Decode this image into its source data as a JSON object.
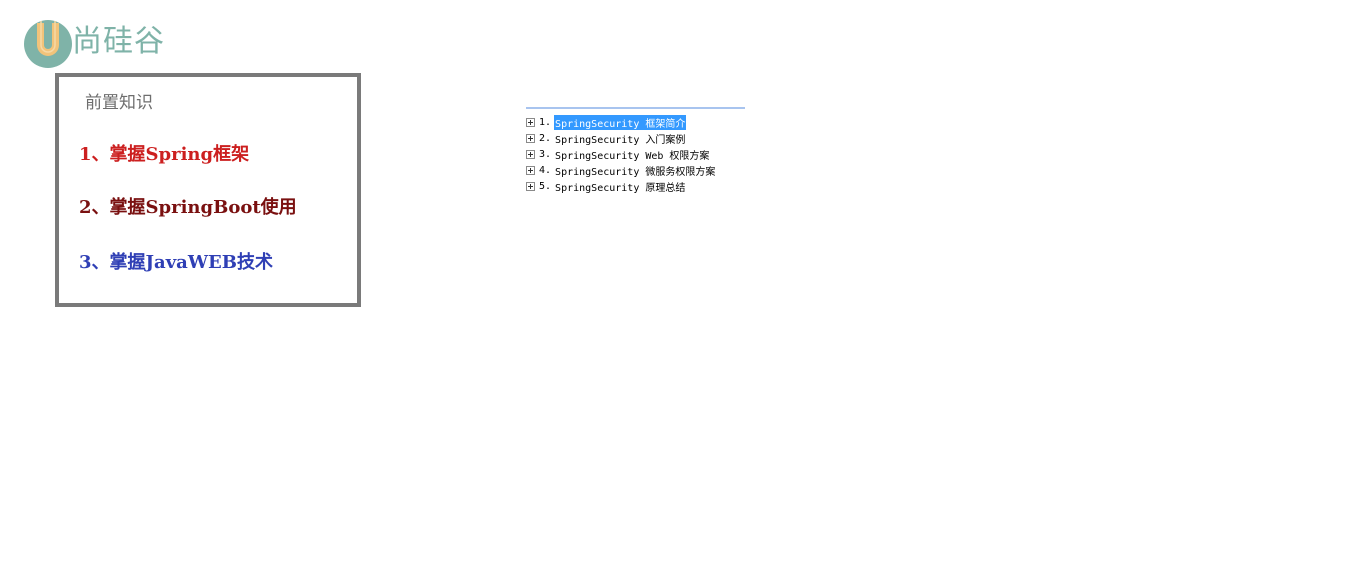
{
  "logo": {
    "brand_text": "尚硅谷",
    "letter": "U",
    "colors": {
      "u_outer": "#f2c37a",
      "u_inner": "#7fb3a8",
      "text": "#7fb3a8"
    }
  },
  "prerequisites": {
    "title": "前置知识",
    "items": [
      {
        "label": "1、掌握Spring框架",
        "color": "#cc1f1f"
      },
      {
        "label": "2、掌握SpringBoot使用",
        "color": "#7a1010"
      },
      {
        "label": "3、掌握JavaWEB技术",
        "color": "#2f3fb5"
      }
    ]
  },
  "toc": {
    "selected_index": 0,
    "selection_color": "#3399ff",
    "items": [
      {
        "number": "1.",
        "label": "SpringSecurity 框架简介",
        "icon": "expand-plus-icon"
      },
      {
        "number": "2.",
        "label": "SpringSecurity 入门案例",
        "icon": "expand-plus-icon"
      },
      {
        "number": "3.",
        "label": "SpringSecurity Web 权限方案",
        "icon": "expand-plus-icon"
      },
      {
        "number": "4.",
        "label": " SpringSecurity 微服务权限方案",
        "icon": "expand-plus-icon"
      },
      {
        "number": "5.",
        "label": " SpringSecurity 原理总结",
        "icon": "expand-plus-icon"
      }
    ]
  }
}
